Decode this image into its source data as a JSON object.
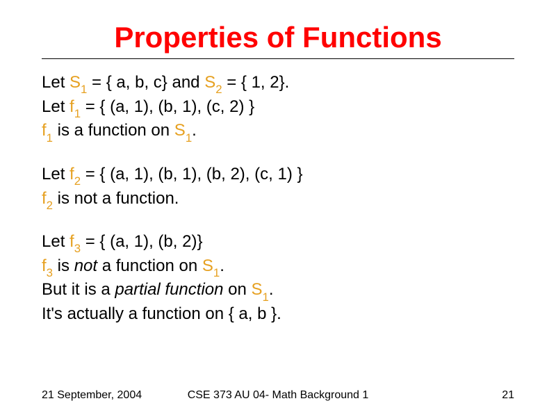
{
  "title": "Properties of Functions",
  "block1": {
    "l1_a": "Let ",
    "l1_s1": "S",
    "l1_s1sub": "1",
    "l1_b": " = { a, b, c} and ",
    "l1_s2": "S",
    "l1_s2sub": "2",
    "l1_c": " = { 1, 2}.",
    "l2_a": "Let ",
    "l2_f": "f",
    "l2_fsub": "1",
    "l2_b": " = { (a, 1), (b, 1), (c, 2) }",
    "l3_f": "f",
    "l3_fsub": "1",
    "l3_a": " is a function on ",
    "l3_s": "S",
    "l3_ssub": "1",
    "l3_b": "."
  },
  "block2": {
    "l1_a": "Let ",
    "l1_f": "f",
    "l1_fsub": "2",
    "l1_b": " = { (a, 1), (b, 1), (b, 2), (c, 1) }",
    "l2_f": "f",
    "l2_fsub": "2",
    "l2_a": " is not a function."
  },
  "block3": {
    "l1_a": "Let ",
    "l1_f": "f",
    "l1_fsub": "3",
    "l1_b": " = { (a, 1), (b, 2)}",
    "l2_f": "f",
    "l2_fsub": "3",
    "l2_a": " is ",
    "l2_not": "not",
    "l2_b": " a function on ",
    "l2_s": "S",
    "l2_ssub": "1",
    "l2_c": ".",
    "l3_a": "But it is a ",
    "l3_pf": "partial function",
    "l3_b": " on ",
    "l3_s": "S",
    "l3_ssub": "1",
    "l3_c": ".",
    "l4": "It's actually a function on { a, b }."
  },
  "footer": {
    "date": "21 September, 2004",
    "course": "CSE 373 AU 04- Math Background 1",
    "page": "21"
  }
}
